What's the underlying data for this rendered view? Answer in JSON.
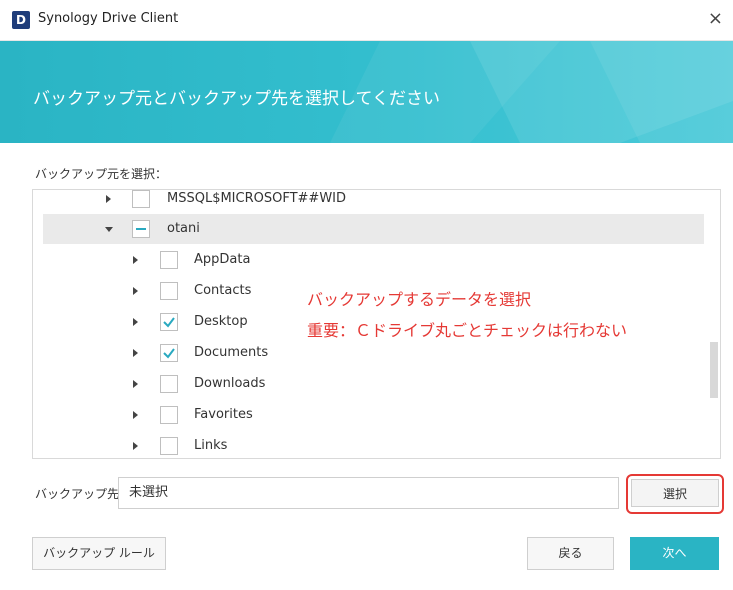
{
  "window": {
    "title": "Synology Drive Client",
    "logo_letter": "D",
    "close_glyph": "×"
  },
  "banner": {
    "title": "バックアップ元とバックアップ先を選択してください"
  },
  "source": {
    "label": "バックアップ元を選択：",
    "tree": [
      {
        "label": "MSSQL$MICROSOFT##WID",
        "expanded": false,
        "check": "none",
        "level": 0
      },
      {
        "label": "otani",
        "expanded": true,
        "check": "partial",
        "level": 0,
        "selected": true
      },
      {
        "label": "AppData",
        "expanded": false,
        "check": "none",
        "level": 1
      },
      {
        "label": "Contacts",
        "expanded": false,
        "check": "none",
        "level": 1
      },
      {
        "label": "Desktop",
        "expanded": false,
        "check": "checked",
        "level": 1
      },
      {
        "label": "Documents",
        "expanded": false,
        "check": "checked",
        "level": 1
      },
      {
        "label": "Downloads",
        "expanded": false,
        "check": "none",
        "level": 1
      },
      {
        "label": "Favorites",
        "expanded": false,
        "check": "none",
        "level": 1
      },
      {
        "label": "Links",
        "expanded": false,
        "check": "none",
        "level": 1
      }
    ]
  },
  "annotation": {
    "line1": "バックアップするデータを選択",
    "line2": "重要：Ｃドライブ丸ごとチェックは行わない",
    "color": "#e53935"
  },
  "destination": {
    "label": "バックアップ先:",
    "value": "未選択",
    "select_button": "選択"
  },
  "footer": {
    "rules_button": "バックアップ ルール",
    "back_button": "戻る",
    "next_button": "次へ"
  },
  "colors": {
    "accent": "#2ab4c4"
  }
}
